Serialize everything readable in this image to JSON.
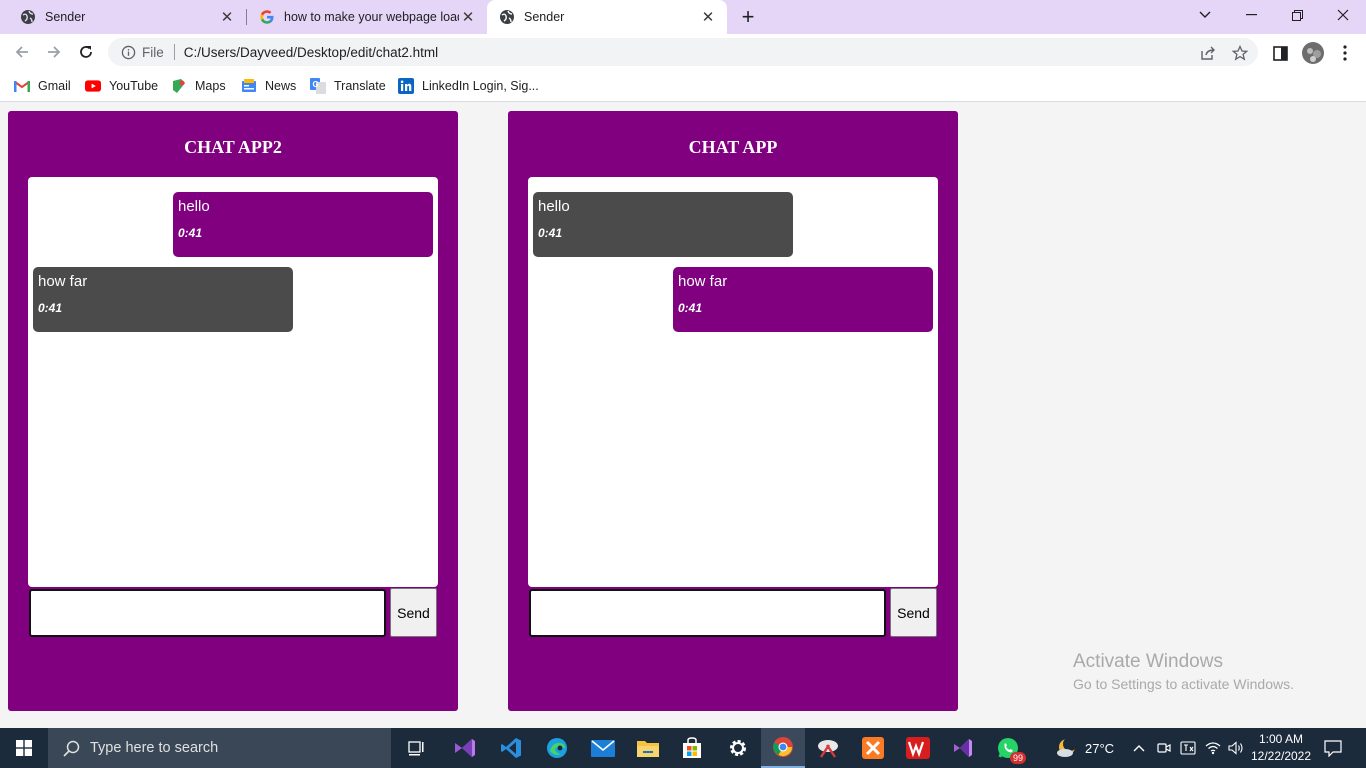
{
  "browser": {
    "tabs": [
      {
        "title": "Sender",
        "active": false
      },
      {
        "title": "how to make your webpage load",
        "active": false
      },
      {
        "title": "Sender",
        "active": true
      }
    ],
    "address": {
      "scheme": "File",
      "url": "C:/Users/Dayveed/Desktop/edit/chat2.html"
    },
    "bookmarks": [
      {
        "label": "Gmail",
        "icon": "gmail-icon"
      },
      {
        "label": "YouTube",
        "icon": "youtube-icon"
      },
      {
        "label": "Maps",
        "icon": "maps-icon"
      },
      {
        "label": "News",
        "icon": "news-icon"
      },
      {
        "label": "Translate",
        "icon": "translate-icon"
      },
      {
        "label": "LinkedIn Login, Sig...",
        "icon": "linkedin-icon"
      }
    ]
  },
  "chats": [
    {
      "title": "CHAT APP2",
      "messages": [
        {
          "text": "hello",
          "time": "0:41",
          "side": "mine"
        },
        {
          "text": "how far",
          "time": "0:41",
          "side": "theirs"
        }
      ],
      "input_value": "",
      "send_label": "Send"
    },
    {
      "title": "CHAT APP",
      "messages": [
        {
          "text": "hello",
          "time": "0:41",
          "side": "theirs"
        },
        {
          "text": "how far",
          "time": "0:41",
          "side": "mine"
        }
      ],
      "input_value": "",
      "send_label": "Send"
    }
  ],
  "watermark": {
    "line1": "Activate Windows",
    "line2": "Go to Settings to activate Windows."
  },
  "taskbar": {
    "search_placeholder": "Type here to search",
    "weather": "27°C",
    "time": "1:00 AM",
    "date": "12/22/2022",
    "whatsapp_badge": "99"
  },
  "colors": {
    "panel": "#800080",
    "sent_bubble": "#800080",
    "received_bubble": "#4b4b4b",
    "tabbar": "#e5d6f7",
    "taskbar": "#1c2b3c"
  }
}
